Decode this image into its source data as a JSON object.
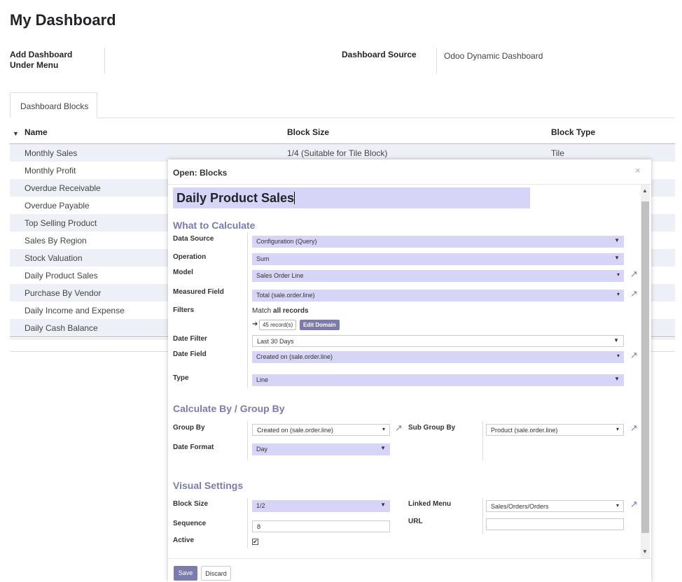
{
  "page": {
    "title": "My Dashboard",
    "add_menu_label_1": "Add Dashboard",
    "add_menu_label_2": "Under Menu",
    "source_label": "Dashboard Source",
    "source_value": "Odoo Dynamic Dashboard",
    "tab_label": "Dashboard Blocks"
  },
  "table": {
    "columns": [
      "Name",
      "Block Size",
      "Block Type"
    ],
    "rows": [
      {
        "name": "Monthly Sales",
        "size": "1/4 (Suitable for Tile Block)",
        "type": "Tile"
      },
      {
        "name": "Monthly Profit"
      },
      {
        "name": "Overdue Receivable"
      },
      {
        "name": "Overdue Payable"
      },
      {
        "name": "Top Selling Product"
      },
      {
        "name": "Sales By Region"
      },
      {
        "name": "Stock Valuation"
      },
      {
        "name": "Daily Product Sales"
      },
      {
        "name": "Purchase By Vendor"
      },
      {
        "name": "Daily Income and Expense"
      },
      {
        "name": "Daily Cash Balance"
      }
    ]
  },
  "modal": {
    "title": "Open: Blocks",
    "close": "×",
    "name_value": "Daily Product Sales",
    "sections": {
      "calc": "What to Calculate",
      "group": "Calculate By / Group By",
      "visual": "Visual Settings"
    },
    "fields": {
      "data_source": {
        "label": "Data Source",
        "value": "Configuration (Query)"
      },
      "operation": {
        "label": "Operation",
        "value": "Sum"
      },
      "model": {
        "label": "Model",
        "value": "Sales Order Line"
      },
      "measured_field": {
        "label": "Measured Field",
        "value": "Total (sale.order.line)"
      },
      "filters": {
        "label": "Filters",
        "match_prefix": "Match ",
        "match_bold": "all records",
        "records": "45 record(s)",
        "edit_domain": "Edit Domain"
      },
      "date_filter": {
        "label": "Date Filter",
        "value": "Last 30 Days"
      },
      "date_field": {
        "label": "Date Field",
        "value": "Created on (sale.order.line)"
      },
      "type": {
        "label": "Type",
        "value": "Line"
      },
      "group_by": {
        "label": "Group By",
        "value": "Created on (sale.order.line)"
      },
      "sub_group_by": {
        "label": "Sub Group By",
        "value": "Product (sale.order.line)"
      },
      "date_format": {
        "label": "Date Format",
        "value": "Day"
      },
      "block_size": {
        "label": "Block Size",
        "value": "1/2"
      },
      "linked_menu": {
        "label": "Linked Menu",
        "value": "Sales/Orders/Orders"
      },
      "sequence": {
        "label": "Sequence",
        "value": "8"
      },
      "url": {
        "label": "URL",
        "value": ""
      },
      "active": {
        "label": "Active",
        "checked": true
      }
    },
    "buttons": {
      "save": "Save",
      "discard": "Discard"
    }
  },
  "colors": {
    "accent": "#7c7bad",
    "field_bg": "#d6d4f7",
    "row_alt": "#eef0f7"
  },
  "icons": {
    "external": "external-link-icon",
    "dropdown": "caret-down-icon",
    "arrow": "arrow-right-icon"
  }
}
